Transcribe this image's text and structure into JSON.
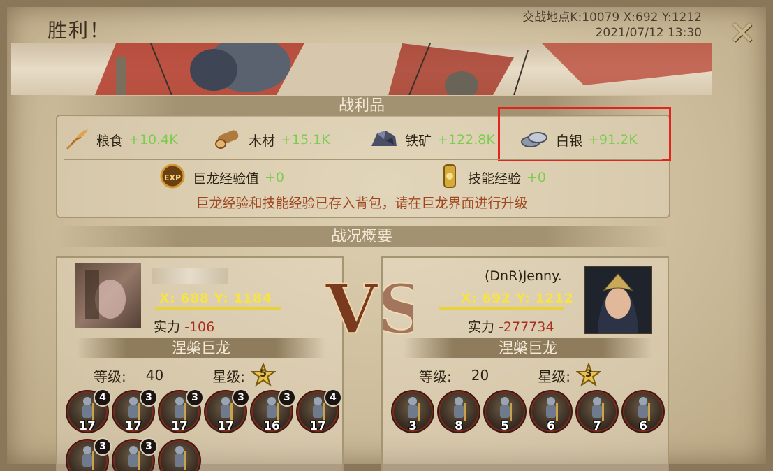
{
  "header": {
    "title": "胜利！",
    "location": "交战地点K:10079 X:692 Y:1212",
    "datetime": "2021/07/12 13:30",
    "close_icon": "close-x-icon"
  },
  "loot": {
    "section_title": "战利品",
    "resources": [
      {
        "icon": "wheat-icon",
        "label": "粮食",
        "value": "+10.4K"
      },
      {
        "icon": "wood-log-icon",
        "label": "木材",
        "value": "+15.1K"
      },
      {
        "icon": "iron-ore-icon",
        "label": "铁矿",
        "value": "+122.8K"
      },
      {
        "icon": "silver-coins-icon",
        "label": "白银",
        "value": "+91.2K"
      }
    ],
    "dragon_exp": {
      "icon": "exp-icon",
      "label": "巨龙经验值",
      "value": "+0"
    },
    "skill_exp": {
      "icon": "skill-scroll-icon",
      "label": "技能经验",
      "value": "+0"
    },
    "notice": "巨龙经验和技能经验已存入背包，请在巨龙界面进行升级",
    "highlight_color": "#e4231f",
    "value_color": "#7ccd4f"
  },
  "overview": {
    "section_title": "战况概要",
    "vs_label": "VS",
    "left": {
      "name": "",
      "coords": "X: 688 Y: 1184",
      "power_label": "实力",
      "power": "-106",
      "dragon": "涅槃巨龙",
      "level_label": "等级:",
      "level": "40",
      "star_label": "星级:",
      "stars": "5",
      "units": [
        {
          "level": "17",
          "badge": "4"
        },
        {
          "level": "17",
          "badge": "3"
        },
        {
          "level": "17",
          "badge": "3"
        },
        {
          "level": "17",
          "badge": "3"
        },
        {
          "level": "16",
          "badge": "3"
        },
        {
          "level": "17",
          "badge": "4"
        },
        {
          "level": "",
          "badge": "3"
        },
        {
          "level": "",
          "badge": "3"
        },
        {
          "level": "",
          "badge": ""
        }
      ]
    },
    "right": {
      "name": "(DnR)Jenny.",
      "coords": "X: 692 Y: 1212",
      "power_label": "实力",
      "power": "-277734",
      "dragon": "涅槃巨龙",
      "level_label": "等级:",
      "level": "20",
      "star_label": "星级:",
      "stars": "3",
      "units": [
        {
          "level": "3",
          "badge": ""
        },
        {
          "level": "8",
          "badge": ""
        },
        {
          "level": "5",
          "badge": ""
        },
        {
          "level": "6",
          "badge": ""
        },
        {
          "level": "7",
          "badge": ""
        },
        {
          "level": "6",
          "badge": ""
        }
      ]
    }
  }
}
